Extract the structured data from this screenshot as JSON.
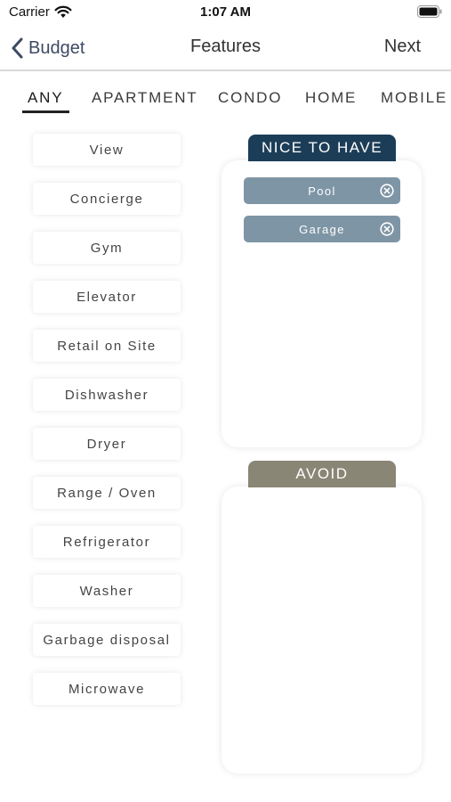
{
  "status_bar": {
    "carrier": "Carrier",
    "time": "1:07 AM"
  },
  "nav": {
    "back_label": "Budget",
    "title": "Features",
    "next_label": "Next"
  },
  "tabs": [
    {
      "label": "ANY",
      "active": true
    },
    {
      "label": "APARTMENT",
      "active": false
    },
    {
      "label": "CONDO",
      "active": false
    },
    {
      "label": "HOME",
      "active": false
    },
    {
      "label": "MOBILE H",
      "active": false
    }
  ],
  "features": [
    "View",
    "Concierge",
    "Gym",
    "Elevator",
    "Retail on Site",
    "Dishwasher",
    "Dryer",
    "Range / Oven",
    "Refrigerator",
    "Washer",
    "Garbage disposal",
    "Microwave"
  ],
  "nice_to_have": {
    "title": "NICE TO HAVE",
    "items": [
      "Pool",
      "Garage"
    ],
    "color": "#1c3d57"
  },
  "avoid": {
    "title": "AVOID",
    "items": [],
    "color": "#8a8675"
  },
  "colors": {
    "chip": "#7e95a5",
    "back_label": "#3d4a63"
  }
}
